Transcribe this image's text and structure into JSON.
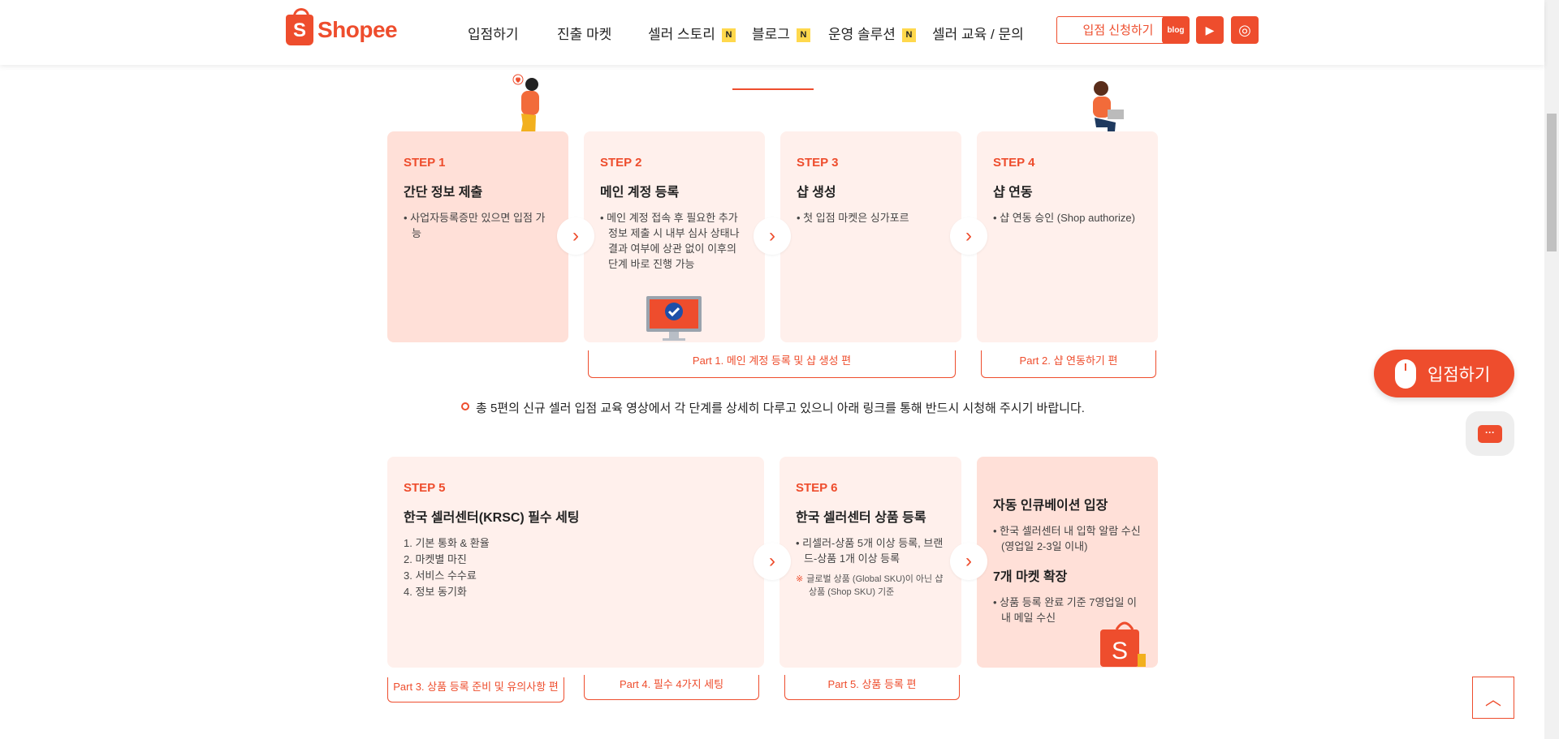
{
  "header": {
    "logo_text": "Shopee",
    "logo_mark": "S",
    "nav": [
      {
        "label": "입점하기",
        "badge": ""
      },
      {
        "label": "진출 마켓",
        "badge": ""
      },
      {
        "label": "셀러 스토리",
        "badge": "N"
      },
      {
        "label": "블로그",
        "badge": "N"
      },
      {
        "label": "운영 솔루션",
        "badge": "N"
      },
      {
        "label": "셀러 교육 / 문의",
        "badge": ""
      }
    ],
    "apply_label": "입점 신청하기",
    "social": [
      {
        "name": "blog-icon",
        "text": "blog"
      },
      {
        "name": "youtube-icon",
        "text": "▶"
      },
      {
        "name": "instagram-icon",
        "text": "◎"
      }
    ]
  },
  "steps_top": [
    {
      "step": "STEP 1",
      "title": "간단 정보 제출",
      "bullets": [
        "사업자등록증만 있으면 입점 가능"
      ]
    },
    {
      "step": "STEP 2",
      "title": "메인 계정 등록",
      "bullets": [
        "메인 계정 접속 후 필요한 추가 정보 제출 시 내부 심사 상태나 결과 여부에 상관 없이 이후의 단계 바로 진행 가능"
      ]
    },
    {
      "step": "STEP 3",
      "title": "샵 생성",
      "bullets": [
        "첫 입점 마켓은 싱가포르"
      ]
    },
    {
      "step": "STEP 4",
      "title": "샵 연동",
      "bullets": [
        "샵 연동 승인 (Shop authorize)"
      ]
    }
  ],
  "parts_top": [
    "Part 1. 메인 계정 등록 및 샵 생성 편",
    "Part 2. 샵 연동하기 편"
  ],
  "notice": "총 5편의 신규 셀러 입점 교육 영상에서 각 단계를 상세히 다루고 있으니 아래 링크를 통해 반드시 시청해 주시기 바랍니다.",
  "step5": {
    "step": "STEP 5",
    "title": "한국 셀러센터(KRSC) 필수 세팅",
    "items": [
      "1. 기본 통화 & 환율",
      "2. 마켓별 마진",
      "3. 서비스 수수료",
      "4. 정보 동기화"
    ]
  },
  "step6": {
    "step": "STEP 6",
    "title": "한국 셀러센터 상품 등록",
    "bullets": [
      "리셀러-상품 5개 이상 등록, 브랜드-상품 1개 이상 등록"
    ],
    "note_mark": "※",
    "note": "글로벌 상품 (Global SKU)이 아닌 샵 상품 (Shop SKU) 기준"
  },
  "step7": {
    "title1": "자동 인큐베이션 입장",
    "bullets1": [
      "한국 셀러센터 내 입학 알람 수신 (영업일 2-3일 이내)"
    ],
    "title2": "7개 마켓 확장",
    "bullets2": [
      "상품 등록 완료 기준 7영업일 이내 메일 수신"
    ]
  },
  "parts_bottom": [
    "Part 3. 상품 등록 준비 및 유의사항 편",
    "Part 4. 필수 4가지 세팅",
    "Part 5. 상품 등록 편"
  ],
  "fab_label": "입점하기",
  "chat_text": "···",
  "top_text": "︿",
  "arrow_glyph": "›",
  "colors": {
    "accent": "#ee4d2d",
    "card_light": "#fff0ec",
    "card_mid": "#ffe0d8"
  }
}
